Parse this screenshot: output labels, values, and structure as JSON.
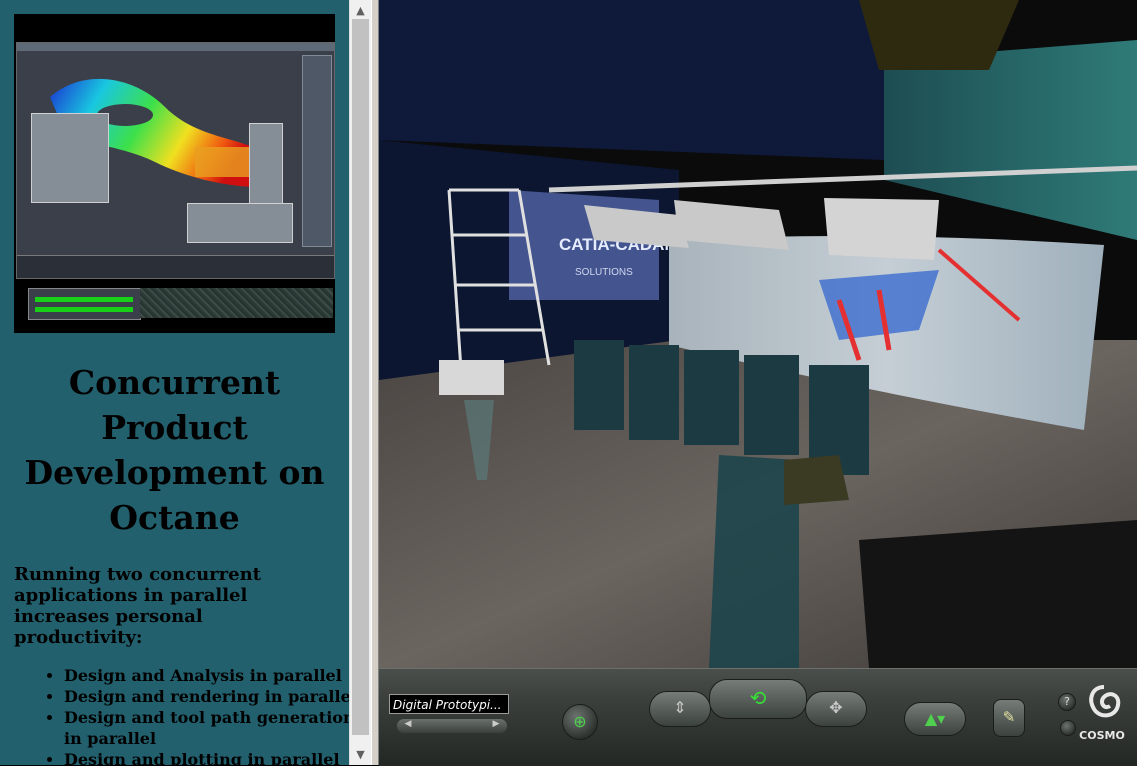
{
  "left_frame": {
    "title": "Concurrent Product Development on Octane",
    "intro": "Running two concurrent applications in parallel increases personal productivity:",
    "bullets": [
      "Design and Analysis in parallel",
      "Design and rendering in parallel",
      "Design and tool path generation in parallel",
      "Design and plotting in parallel"
    ]
  },
  "scene": {
    "banner_text": "CATIA-CADAM",
    "banner_subtext": "SOLUTIONS"
  },
  "dashboard": {
    "viewpoint_label": "Digital Prototypi...",
    "help_label": "?",
    "logo_text": "COSMO",
    "icons": {
      "viewpoint_nav": "left-right-arrows-icon",
      "seek": "seek-crosshair-icon",
      "walk": "walk-icon",
      "rotate": "rotate-icon",
      "pan": "pan-icon",
      "tilt": "tilt-icon",
      "straighten": "straighten-icon",
      "help": "help-icon",
      "logo": "cosmo-logo-icon"
    }
  }
}
